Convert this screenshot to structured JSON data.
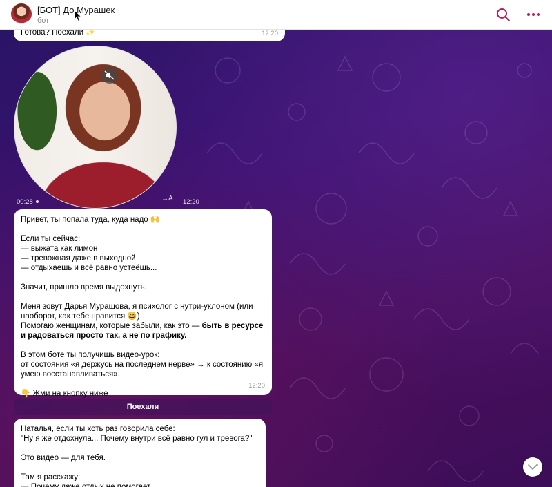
{
  "header": {
    "title": "[БОТ] До Мурашек",
    "subtitle": "бот",
    "icons": [
      "search-icon",
      "more-icon"
    ],
    "accent_color": "#c2185b"
  },
  "messages": {
    "m1": {
      "text": "Готова? Поехали ✨",
      "time": "12:20"
    },
    "video": {
      "duration": "00:28",
      "translate_label": "→A",
      "time": "12:20",
      "mute_icon": "speaker-muted-icon"
    },
    "m2": {
      "greeting": "Привет, ты попала туда, куда надо 🙌",
      "if_now": "Если ты сейчас:\n— выжата как лимон\n— тревожная даже в выходной\n— отдыхаешь и всё равно устеёшь...",
      "means": "Значит, пришло время выдохнуть.",
      "intro_a": "Меня зовут Дарья Мурашова, я психолог с нутри-уклоном (или наоборот, как тебе нравится 😄)\nПомогаю женщинам, которые забыли, как это — ",
      "intro_bold": "быть в ресурсе и радоваться просто так, а не по графику.",
      "lesson": "В этом боте ты получишь видео-урок:\nот состояния «я держусь на последнем нерве» → к состоянию «я умею восстанавливаться».",
      "cta": "👇 Жми на кнопку ниже",
      "time": "12:20"
    },
    "keyboard_button": "Поехали",
    "m3": {
      "line1": "Наталья, если ты хоть раз говорила себе:\n\"Ну я же отдохнула... Почему внутри всё равно гул и тревога?\"",
      "line2": "Это видео — для тебя.",
      "line3": "Там я расскажу:\n— Почему даже отдых не помогает"
    }
  },
  "colors": {
    "bubble": "#ffffff",
    "bg_dark": "#2a1466",
    "bg_magenta": "#4a0f5e"
  }
}
